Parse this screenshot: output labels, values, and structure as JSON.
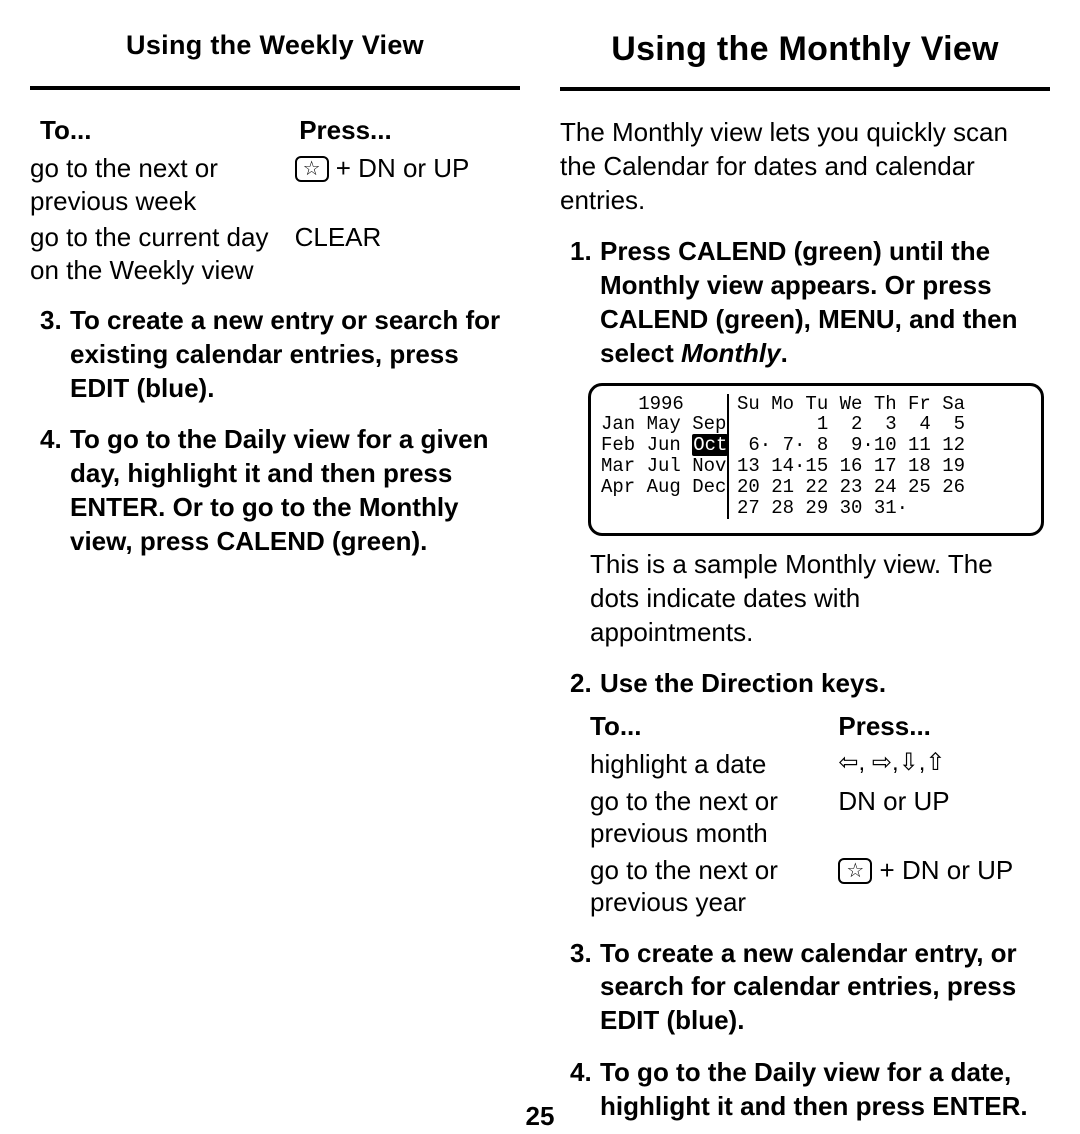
{
  "pageNumber": "25",
  "left": {
    "heading": "Using the Weekly View",
    "tableHead": {
      "to": "To...",
      "press": "Press..."
    },
    "rows": [
      {
        "to": "go to the next or previous week",
        "pressPrefixStar": true,
        "pressSuffix": " + DN or UP"
      },
      {
        "to": "go to the current day on the Weekly view",
        "press": "CLEAR"
      }
    ],
    "items": [
      {
        "num": "3.",
        "text": "To create a new entry or search for existing calendar entries, press EDIT (blue)."
      },
      {
        "num": "4.",
        "text": "To go to the Daily view for a given day, highlight it and then press ENTER. Or to go to the Monthly view, press CALEND (green)."
      }
    ]
  },
  "right": {
    "heading": "Using the Monthly View",
    "intro": "The Monthly view lets you quickly scan the Calendar for dates and calendar entries.",
    "step1": {
      "num": "1.",
      "prefix": "Press CALEND (green) until the Monthly view appears. Or press CALEND (green), MENU, and then select ",
      "italic": "Monthly",
      "suffix": "."
    },
    "lcd": {
      "year": "1996",
      "months": [
        [
          "Jan",
          "May",
          "Sep"
        ],
        [
          "Feb",
          "Jun",
          "Oct"
        ],
        [
          "Mar",
          "Jul",
          "Nov"
        ],
        [
          "Apr",
          "Aug",
          "Dec"
        ]
      ],
      "selectedMonth": "Oct",
      "dayHead": "Su Mo Tu We Th Fr Sa",
      "weeks": [
        "       1  2  3  4  5",
        " 6· 7· 8  9·10 11 12",
        "13 14·15 16 17 18 19",
        "20 21 22 23 24 25 26",
        "27 28 29 30 31·"
      ]
    },
    "caption": "This is a sample Monthly view. The dots indicate dates with appointments.",
    "step2": {
      "num": "2.",
      "text": "Use the Direction keys."
    },
    "tableHead": {
      "to": "To...",
      "press": "Press..."
    },
    "rows": [
      {
        "to": "highlight a date",
        "arrows": "⇦, ⇨,⇩,⇧"
      },
      {
        "to": "go to the next or previous month",
        "press": "DN or UP"
      },
      {
        "to": "go to the next or previous year",
        "pressPrefixStar": true,
        "pressSuffix": " + DN or UP"
      }
    ],
    "step3": {
      "num": "3.",
      "text": "To create a new calendar entry, or search for calendar entries, press EDIT (blue)."
    },
    "step4": {
      "num": "4.",
      "text": "To go to the Daily view for a date, highlight it and then press ENTER."
    }
  }
}
